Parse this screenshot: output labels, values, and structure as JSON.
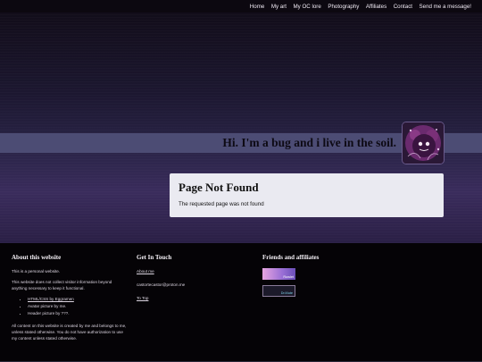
{
  "nav": {
    "items": [
      "Home",
      "My art",
      "My OC lore",
      "Photography",
      "Affiliates",
      "Contact",
      "Send me a message!"
    ]
  },
  "header": {
    "tagline": "Hi. I'm a bug and i live in the soil.",
    "avatar_icon": "bug-avatar"
  },
  "notfound": {
    "title": "Page Not Found",
    "message": "The requested page was not found"
  },
  "footer": {
    "about": {
      "heading": "About this website",
      "p1": "This is a personal website.",
      "p2": "This website does not collect visitor information beyond anything necessary to keep it functional.",
      "credits": [
        "HTML/CSS by Eggramen",
        "Avatar picture by me.",
        "Header picture by ???."
      ],
      "p3": "All content on this website is created by me and belongs to me, unless stated otherwise. You do not have authorization to use my content unless stated otherwise."
    },
    "contact": {
      "heading": "Get In Touch",
      "about_me": "About me",
      "email": "castortecastor@proton.me",
      "to_top": "To Top"
    },
    "friends": {
      "heading": "Friends and affiliates",
      "badges": [
        "Rowlet",
        "Dr.Mute"
      ]
    }
  }
}
